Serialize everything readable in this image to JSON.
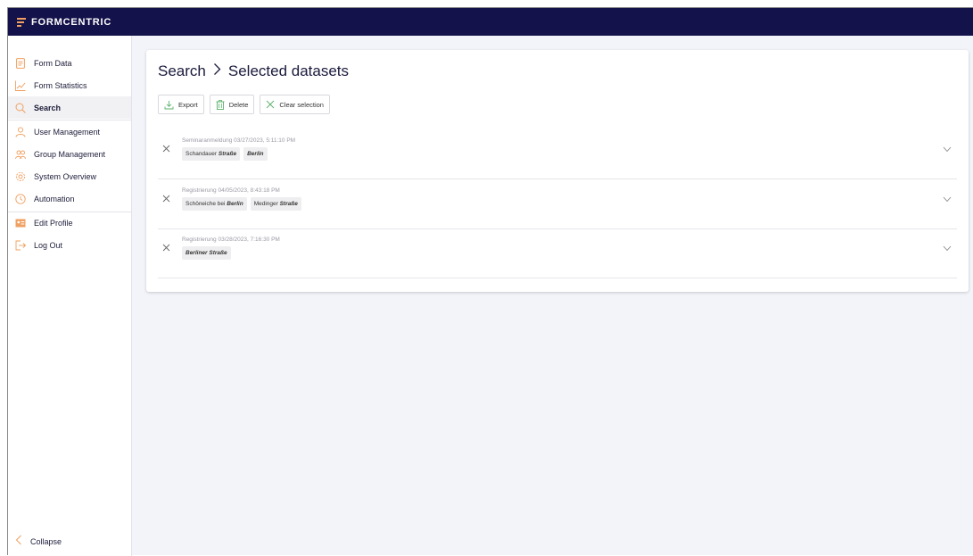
{
  "app": {
    "brand": "FORMCENTRIC",
    "accent": "#f0a060",
    "topbar_color": "#14124a"
  },
  "sidebar": {
    "items": [
      {
        "label": "Form Data",
        "icon": "document-icon"
      },
      {
        "label": "Form Statistics",
        "icon": "line-chart-icon"
      },
      {
        "label": "Search",
        "icon": "search-icon"
      },
      {
        "label": "User Management",
        "icon": "user-icon"
      },
      {
        "label": "Group Management",
        "icon": "group-icon"
      },
      {
        "label": "System Overview",
        "icon": "gear-icon"
      },
      {
        "label": "Automation",
        "icon": "clock-icon"
      },
      {
        "label": "Edit Profile",
        "icon": "id-card-icon"
      },
      {
        "label": "Log Out",
        "icon": "logout-icon"
      }
    ],
    "active": "Search",
    "collapse_label": "Collapse"
  },
  "main": {
    "breadcrumb_root": "Search",
    "breadcrumb_current": "Selected datasets",
    "toolbar": {
      "export_label": "Export",
      "delete_label": "Delete",
      "clear_label": "Clear selection"
    },
    "datasets": [
      {
        "meta": "Seminaranmeldung 03/27/2023, 5:11:10 PM",
        "tags": [
          {
            "plain": "Schandauer ",
            "bold": "Straße"
          },
          {
            "plain": "",
            "bold": "Berlin"
          }
        ]
      },
      {
        "meta": "Registrierung 04/05/2023, 8:43:18 PM",
        "tags": [
          {
            "plain": "Schöneiche bei ",
            "bold": "Berlin"
          },
          {
            "plain": "Medinger ",
            "bold": "Straße"
          }
        ]
      },
      {
        "meta": "Registrierung 03/28/2023, 7:16:30 PM",
        "tags": [
          {
            "plain": "",
            "bold": "Berliner Straße"
          }
        ]
      }
    ]
  }
}
